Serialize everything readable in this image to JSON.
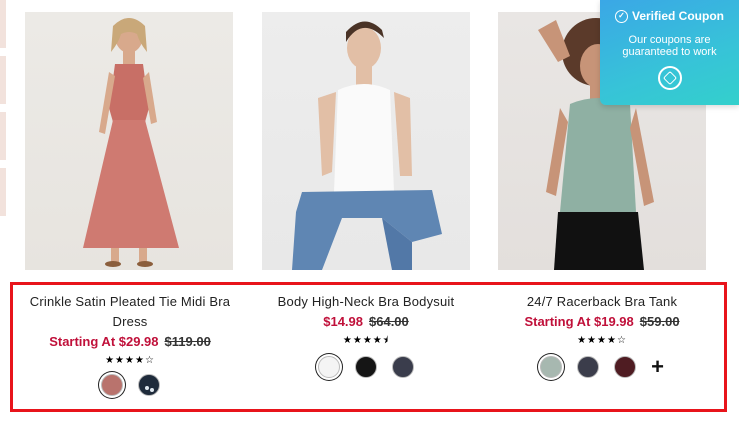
{
  "products": [
    {
      "title": "Crinkle Satin Pleated Tie Midi Bra Dress",
      "price": "Starting At $29.98",
      "original_price": "$119.00",
      "rating": "★★★★☆",
      "swatches": [
        {
          "color": "#b9736d",
          "selected": true
        },
        {
          "color": "#1f2b3b",
          "pattern": "dots",
          "selected": false
        }
      ]
    },
    {
      "title": "Body High-Neck Bra Bodysuit",
      "price": "$14.98",
      "original_price": "$64.00",
      "rating": "★★★★⯨",
      "swatches": [
        {
          "color": "#f4f4f4",
          "selected": true
        },
        {
          "color": "#151515",
          "selected": false
        },
        {
          "color": "#3a3d4c",
          "selected": false
        }
      ]
    },
    {
      "title": "24/7 Racerback Bra Tank",
      "price": "Starting At $19.98",
      "original_price": "$59.00",
      "rating": "★★★★☆",
      "swatches": [
        {
          "color": "#a7b8b0",
          "selected": true
        },
        {
          "color": "#3b3d4b",
          "selected": false
        },
        {
          "color": "#4f1c22",
          "selected": false
        }
      ],
      "more_colors": "+"
    }
  ],
  "coupon": {
    "title": "Verified Coupon",
    "subtitle": "Our coupons are guaranteed to work"
  },
  "colors": {
    "sale_price": "#c0103a",
    "highlight_border": "#e8141b",
    "coupon_gradient_start": "#3aa7e6",
    "coupon_gradient_end": "#33d0cc"
  }
}
